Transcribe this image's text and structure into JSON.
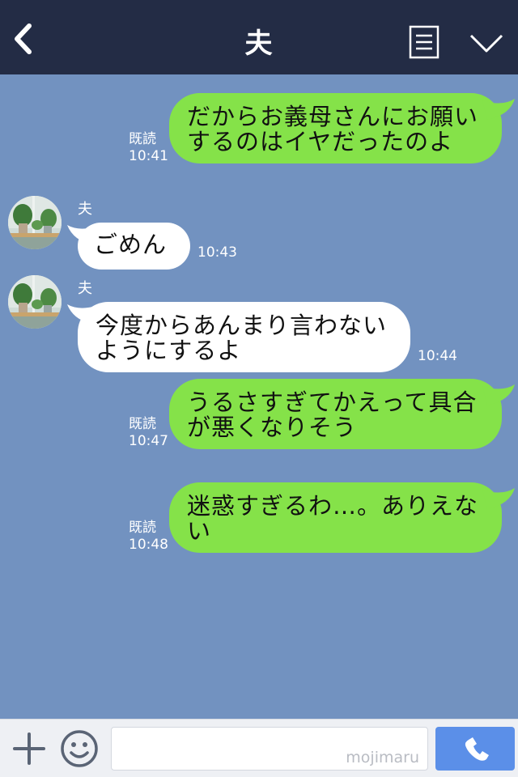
{
  "header": {
    "title": "夫",
    "back_icon": "chevron-left-icon",
    "menu_icon": "document-lines-icon",
    "collapse_icon": "chevron-down-icon"
  },
  "messages": [
    {
      "side": "right",
      "lines": [
        "だからお義母さんにお願い",
        "するのはイヤだったのよ"
      ],
      "read": "既読",
      "time": "10:41"
    },
    {
      "side": "left",
      "sender": "夫",
      "lines": [
        "ごめん"
      ],
      "time": "10:43"
    },
    {
      "side": "left",
      "sender": "夫",
      "lines": [
        "今度からあんまり言わない",
        "ようにするよ"
      ],
      "time": "10:44"
    },
    {
      "side": "right",
      "lines": [
        "うるさすぎてかえって具合",
        "が悪くなりそう"
      ],
      "read": "既読",
      "time": "10:47"
    },
    {
      "side": "right",
      "lines": [
        "迷惑すぎるわ…。ありえな",
        "い"
      ],
      "read": "既読",
      "time": "10:48"
    }
  ],
  "footer": {
    "plus_icon": "plus-icon",
    "emoji_icon": "smiley-icon",
    "input_value": "",
    "watermark": "mojimaru",
    "call_icon": "phone-icon"
  },
  "colors": {
    "header_bg": "#232c45",
    "chat_bg": "#7292c0",
    "own_bubble": "#85e249",
    "other_bubble": "#ffffff",
    "call_button": "#5b8fe8"
  }
}
